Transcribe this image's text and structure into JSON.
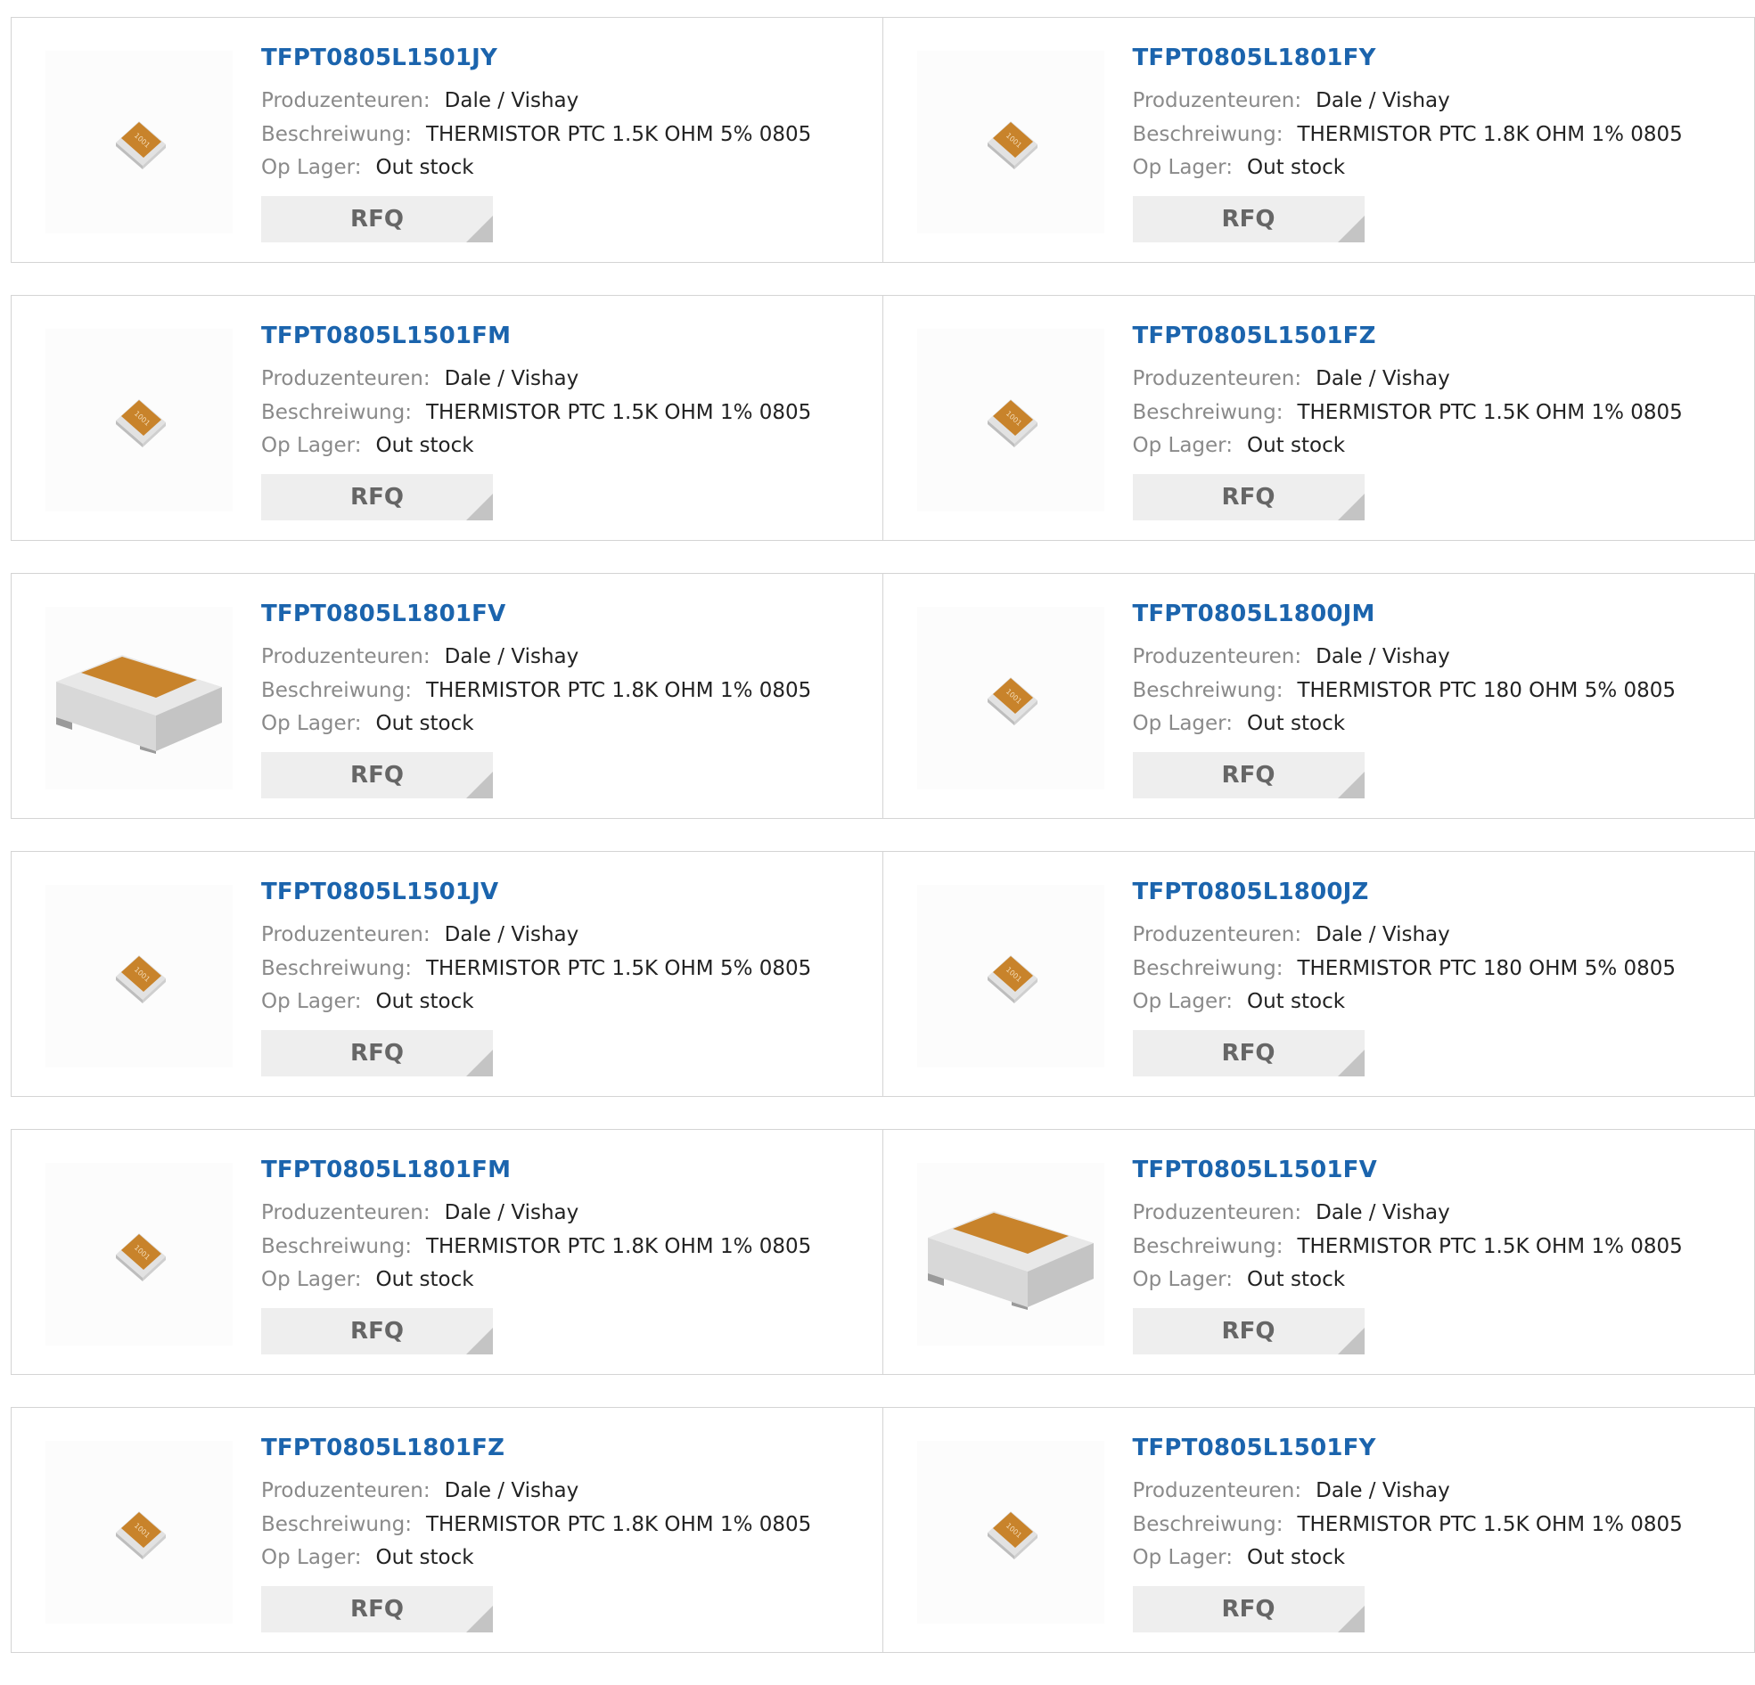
{
  "labels": {
    "manufacturer": "Produzenteuren:",
    "description": "Beschreiwung:",
    "stock": "Op Lager:",
    "rfq": "RFQ"
  },
  "products": [
    {
      "part": "TFPT0805L1501JY",
      "manufacturer": "Dale / Vishay",
      "description": "THERMISTOR PTC 1.5K OHM 5% 0805",
      "stock": "Out stock",
      "image": "smd-chip-small"
    },
    {
      "part": "TFPT0805L1801FY",
      "manufacturer": "Dale / Vishay",
      "description": "THERMISTOR PTC 1.8K OHM 1% 0805",
      "stock": "Out stock",
      "image": "smd-chip-small"
    },
    {
      "part": "TFPT0805L1501FM",
      "manufacturer": "Dale / Vishay",
      "description": "THERMISTOR PTC 1.5K OHM 1% 0805",
      "stock": "Out stock",
      "image": "smd-chip-small"
    },
    {
      "part": "TFPT0805L1501FZ",
      "manufacturer": "Dale / Vishay",
      "description": "THERMISTOR PTC 1.5K OHM 1% 0805",
      "stock": "Out stock",
      "image": "smd-chip-small"
    },
    {
      "part": "TFPT0805L1801FV",
      "manufacturer": "Dale / Vishay",
      "description": "THERMISTOR PTC 1.8K OHM 1% 0805",
      "stock": "Out stock",
      "image": "smd-chip-large"
    },
    {
      "part": "TFPT0805L1800JM",
      "manufacturer": "Dale / Vishay",
      "description": "THERMISTOR PTC 180 OHM 5% 0805",
      "stock": "Out stock",
      "image": "smd-chip-small"
    },
    {
      "part": "TFPT0805L1501JV",
      "manufacturer": "Dale / Vishay",
      "description": "THERMISTOR PTC 1.5K OHM 5% 0805",
      "stock": "Out stock",
      "image": "smd-chip-small"
    },
    {
      "part": "TFPT0805L1800JZ",
      "manufacturer": "Dale / Vishay",
      "description": "THERMISTOR PTC 180 OHM 5% 0805",
      "stock": "Out stock",
      "image": "smd-chip-small"
    },
    {
      "part": "TFPT0805L1801FM",
      "manufacturer": "Dale / Vishay",
      "description": "THERMISTOR PTC 1.8K OHM 1% 0805",
      "stock": "Out stock",
      "image": "smd-chip-small"
    },
    {
      "part": "TFPT0805L1501FV",
      "manufacturer": "Dale / Vishay",
      "description": "THERMISTOR PTC 1.5K OHM 1% 0805",
      "stock": "Out stock",
      "image": "smd-chip-large"
    },
    {
      "part": "TFPT0805L1801FZ",
      "manufacturer": "Dale / Vishay",
      "description": "THERMISTOR PTC 1.8K OHM 1% 0805",
      "stock": "Out stock",
      "image": "smd-chip-small"
    },
    {
      "part": "TFPT0805L1501FY",
      "manufacturer": "Dale / Vishay",
      "description": "THERMISTOR PTC 1.5K OHM 1% 0805",
      "stock": "Out stock",
      "image": "smd-chip-small"
    }
  ],
  "chip_marking": "1001",
  "colors": {
    "part_link": "#1b64ad",
    "label": "#8a8a8a",
    "value": "#222222",
    "chip_body": "#c8832b",
    "chip_terminal": "#e6e6e6",
    "rfq_bg": "#eeeeee",
    "border": "#d4d4d4"
  }
}
